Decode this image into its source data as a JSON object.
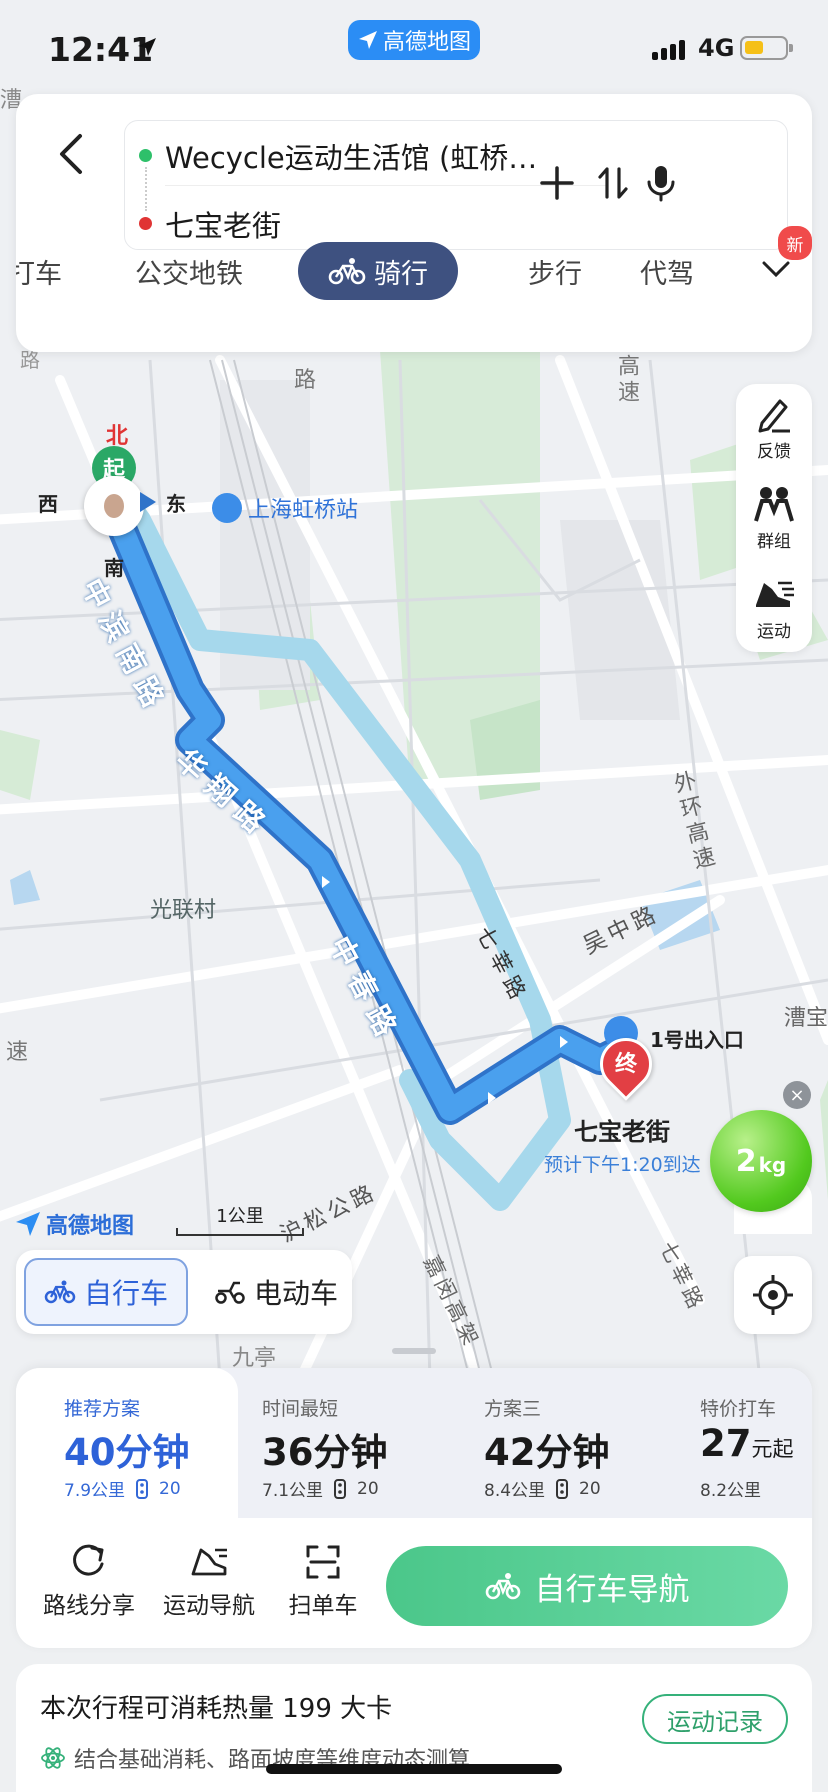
{
  "status_bar": {
    "time": "12:41",
    "app_pill": "高德地图",
    "network": "4G"
  },
  "route": {
    "origin": "Wecycle运动生活馆 (虹桥…",
    "destination": "七宝老街"
  },
  "modes": [
    {
      "label": "打车"
    },
    {
      "label": "公交地铁"
    },
    {
      "label": "骑行"
    },
    {
      "label": "步行"
    },
    {
      "label": "代驾"
    }
  ],
  "new_badge": "新",
  "tools": {
    "feedback": "反馈",
    "group": "群组",
    "sport": "运动"
  },
  "map": {
    "compass_north": "北",
    "compass_start": "起",
    "compass_west": "西",
    "compass_east": "东",
    "compass_south": "南",
    "station": "上海虹桥站",
    "road_zhongbin": "中滨南路",
    "road_huaxiang": "华翔路",
    "road_zhongchun": "中春路",
    "road_qixin": "七莘路",
    "road_wuzhong": "吴中路",
    "road_husong": "沪松公路",
    "road_jiamin": "嘉闵高架",
    "road_qixin2": "七莘路",
    "road_huanhuan": "外环高速",
    "road_gaosu": "高速",
    "road_lu": "路",
    "road_lu2": "路",
    "road_su": "速",
    "road_cao": "漕",
    "road_caobao": "漕宝",
    "village": "光联村",
    "jiuting": "九亭",
    "exit": "1号出入口",
    "end_pin": "终",
    "dest_name": "七宝老街",
    "eta": "预计下午1:20到达"
  },
  "carbon": {
    "value": "2",
    "unit": "kg"
  },
  "scale": "1公里",
  "map_logo": "高德地图",
  "vehicle": {
    "bike": "自行车",
    "ebike": "电动车"
  },
  "plans": [
    {
      "header": "推荐方案",
      "time": "40分钟",
      "dist": "7.9公里",
      "lights": "20"
    },
    {
      "header": "时间最短",
      "time": "36分钟",
      "dist": "7.1公里",
      "lights": "20"
    },
    {
      "header": "方案三",
      "time": "42分钟",
      "dist": "8.4公里",
      "lights": "20"
    },
    {
      "header": "特价打车",
      "time": "27",
      "time_unit": "元起",
      "dist": "8.2公里"
    }
  ],
  "actions": {
    "share": "路线分享",
    "sport_nav": "运动导航",
    "scan": "扫单车",
    "nav_button": "自行车导航"
  },
  "calorie": {
    "title": "本次行程可消耗热量 199 大卡",
    "desc": "结合基础消耗、路面坡度等维度动态测算",
    "record": "运动记录"
  },
  "colors": {
    "route_main": "#3d8ee6",
    "route_alt": "#a6d8ec",
    "nav_green": "#4bc78a",
    "active_mode": "#3e5180",
    "accent_blue": "#2e62d8"
  }
}
